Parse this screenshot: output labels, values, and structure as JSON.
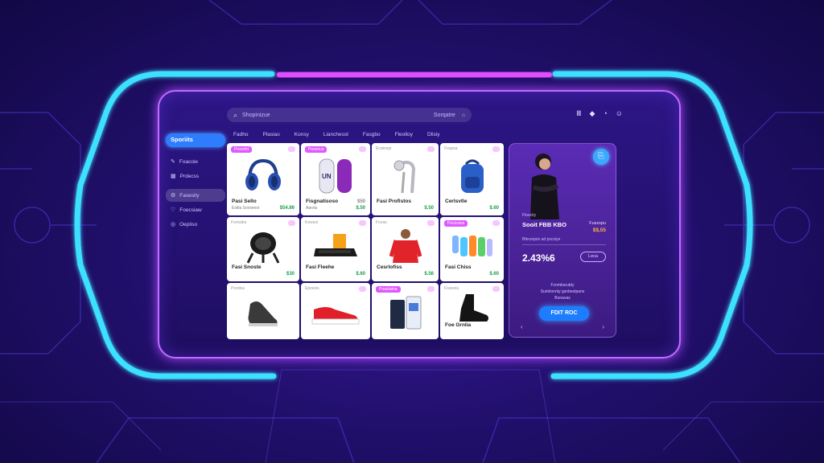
{
  "search": {
    "placeholder": "Shopinizue",
    "right_label": "Sorqatre"
  },
  "top_icons": [
    "menu-icon",
    "shield-icon",
    "bell-icon",
    "user-icon"
  ],
  "categories": [
    "Fadho",
    "Plasiao",
    "Konsy",
    "Lianchesst",
    "Fasgbo",
    "Fleolloy",
    "Dlisiy"
  ],
  "sidebar": {
    "heading": "Sporiits",
    "items": [
      {
        "icon": "edit-icon",
        "label": "Foacoie"
      },
      {
        "icon": "grid-icon",
        "label": "Prdecss"
      },
      {
        "icon": "gear-icon",
        "label": "Fasesity"
      },
      {
        "icon": "heart-icon",
        "label": "Foecsiaw"
      },
      {
        "icon": "settings-icon",
        "label": "Oepiiso"
      }
    ]
  },
  "products": [
    {
      "tag": "Pesonld",
      "name": "Pasi Sello",
      "sub": "Estila Sovsenst",
      "price": "$54.86",
      "kind": "headphones"
    },
    {
      "tag": "Pesenus",
      "name": "Fisgnatisoso",
      "sub": "Aarolu",
      "price": "$50",
      "price2": "$.50",
      "kind": "shoes-side"
    },
    {
      "tag": "Ecdesqn",
      "name": "Fasi Profistos",
      "sub": "",
      "price": "$.50",
      "kind": "sprinkler"
    },
    {
      "tag": "Fospsa",
      "name": "Cerlsvtle",
      "sub": "",
      "price": "$.60",
      "kind": "backpack"
    },
    {
      "tag": "Fomaibu",
      "name": "Fasi Snoste",
      "sub": "",
      "price": "$30",
      "kind": "helmet"
    },
    {
      "tag": "Kowsoi",
      "name": "Fasi Fleehe",
      "sub": "",
      "price": "$.60",
      "kind": "keyboard"
    },
    {
      "tag": "Fovas",
      "name": "Cesrlofiss",
      "sub": "",
      "price": "$.56",
      "kind": "hoodie"
    },
    {
      "tag": "Pesiceiss",
      "name": "Fasi Chiss",
      "sub": "",
      "price": "$.60",
      "kind": "bottles"
    },
    {
      "tag": "Poodsa",
      "name": "",
      "sub": "",
      "price": "",
      "kind": "sneaker"
    },
    {
      "tag": "Epoeiss",
      "name": "",
      "sub": "",
      "price": "",
      "kind": "red-sneaker"
    },
    {
      "tag": "Poaotaina",
      "name": "",
      "sub": "",
      "price": "",
      "kind": "box"
    },
    {
      "tag": "Foeeoia",
      "name": "Foe Grnlia",
      "sub": "",
      "price": "",
      "kind": "boot"
    }
  ],
  "promo": {
    "badge_icon": "edit-icon",
    "category": "Floeciiy",
    "title": "Sooit FBB KBO",
    "tag": "Fuszspu",
    "price": "$$,55",
    "divider_label": "Bfeceqoio ad pscsiye",
    "big_value": "2.43%6",
    "pill_label": "Leca",
    "description": [
      "Fcnmbsrutdy",
      "Suriolonnty gsnbestpans",
      "Bonavas"
    ],
    "cta_label": "FDIT ROC",
    "prev": "‹",
    "next": "›"
  }
}
